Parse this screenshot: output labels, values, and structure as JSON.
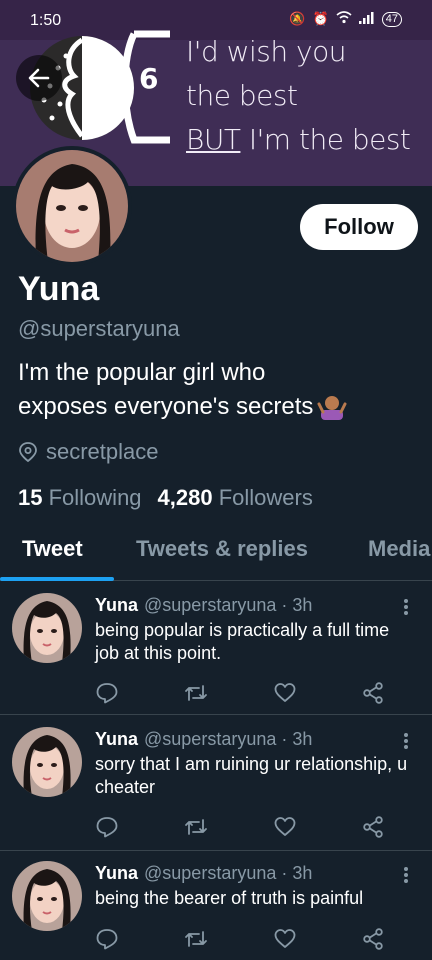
{
  "status": {
    "time": "1:50",
    "battery": "47"
  },
  "banner": {
    "line1": "I'd wish you",
    "line2": "the best",
    "line3a": "BUT",
    "line3b": " I'm the best",
    "logo_number": "6"
  },
  "profile": {
    "follow_label": "Follow",
    "name": "Yuna",
    "handle": "@superstaryuna",
    "bio_line1": "I'm the popular girl who",
    "bio_line2": "exposes everyone's secrets",
    "location": "secretplace",
    "following_count": "15",
    "following_label": "Following",
    "followers_count": "4,280",
    "followers_label": "Followers"
  },
  "tabs": [
    {
      "label": "Tweet"
    },
    {
      "label": "Tweets & replies"
    },
    {
      "label": "Media"
    }
  ],
  "tweets": [
    {
      "name": "Yuna",
      "meta": "@superstaryuna · 3h",
      "text": "being popular is practically a full time job at this point."
    },
    {
      "name": "Yuna",
      "meta": "@superstaryuna · 3h",
      "text": "sorry that I am ruining ur relationship, u cheater"
    },
    {
      "name": "Yuna",
      "meta": "@superstaryuna · 3h",
      "text": "being the bearer of truth is painful"
    }
  ],
  "colors": {
    "background": "#15202b",
    "banner": "#3f2d55",
    "accent": "#1da1f2",
    "muted": "#8899a6"
  }
}
